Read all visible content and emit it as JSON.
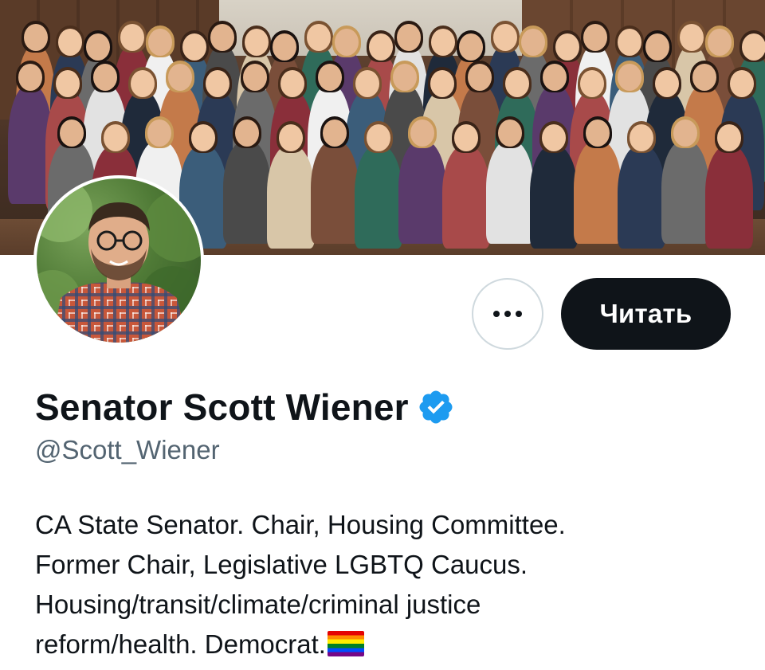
{
  "banner": {
    "image_name": "group-photo-banner"
  },
  "avatar": {
    "image_name": "profile-photo"
  },
  "actions": {
    "more_icon": "ellipsis-icon",
    "follow_label": "Читать"
  },
  "profile": {
    "display_name": "Senator Scott Wiener",
    "verified_icon": "verified-badge-icon",
    "verified_color": "#1d9bf0",
    "handle": "@Scott_Wiener",
    "bio_lines": [
      "CA State Senator. Chair, Housing Committee.",
      "Former Chair, Legislative LGBTQ Caucus.",
      "Housing/transit/climate/criminal justice",
      "reform/health. Democrat."
    ],
    "bio_emoji": "rainbow-flag-icon"
  },
  "colors": {
    "text_primary": "#0f1419",
    "text_secondary": "#536471",
    "button_dark": "#0f1419",
    "button_border": "#cfd9de"
  }
}
